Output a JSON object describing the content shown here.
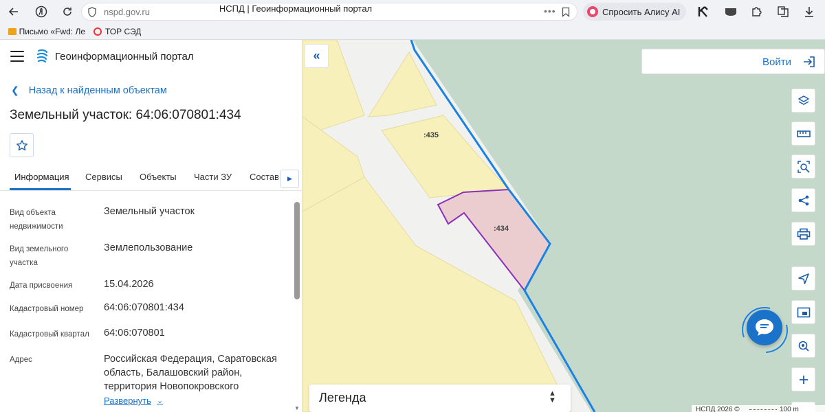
{
  "browser": {
    "url": "nspd.gov.ru",
    "page_title": "НСПД | Геоинформационный портал",
    "alice_button": "Спросить Алису AI",
    "bookmarks": [
      {
        "label": "Письмо «Fwd: Ле"
      },
      {
        "label": "ТОР СЭД"
      }
    ]
  },
  "header": {
    "portal_name": "Геоинформационный портал"
  },
  "panel": {
    "back_label": "Назад к найденным объектам",
    "title": "Земельный участок: 64:06:070801:434",
    "tabs": [
      {
        "label": "Информация"
      },
      {
        "label": "Сервисы"
      },
      {
        "label": "Объекты"
      },
      {
        "label": "Части ЗУ"
      },
      {
        "label": "Состав"
      }
    ],
    "rows": [
      {
        "label": "Вид объекта недвижимости",
        "value": "Земельный участок"
      },
      {
        "label": "Вид земельного участка",
        "value": "Землепользование"
      },
      {
        "label": "Дата присвоения",
        "value": "15.04.2026"
      },
      {
        "label": "Кадастровый номер",
        "value": "64:06:070801:434"
      },
      {
        "label": "Кадастровый квартал",
        "value": "64:06:070801"
      },
      {
        "label": "Адрес",
        "value": "Российская Федерация, Саратовская область, Балашовский район, территория Новопокровского"
      }
    ],
    "expand_label": "Развернуть"
  },
  "map": {
    "login_label": "Войти",
    "parcel_labels": [
      ":435",
      ":434"
    ],
    "legend_title": "Легенда",
    "scale_left": "НСПД 2026 ©",
    "scale_right": "100 m",
    "colors": {
      "land": "#f7f0bb",
      "water": "#c5d9cb",
      "selected_parcel": "#ebcdd0",
      "selected_border": "#8b2fb8",
      "boundary": "#1a82e2"
    },
    "tools": [
      "layers-icon",
      "ruler-icon",
      "select-area-icon",
      "share-icon",
      "print-icon",
      "locate-icon",
      "minimap-icon",
      "search-location-icon",
      "zoom-in-icon"
    ]
  }
}
